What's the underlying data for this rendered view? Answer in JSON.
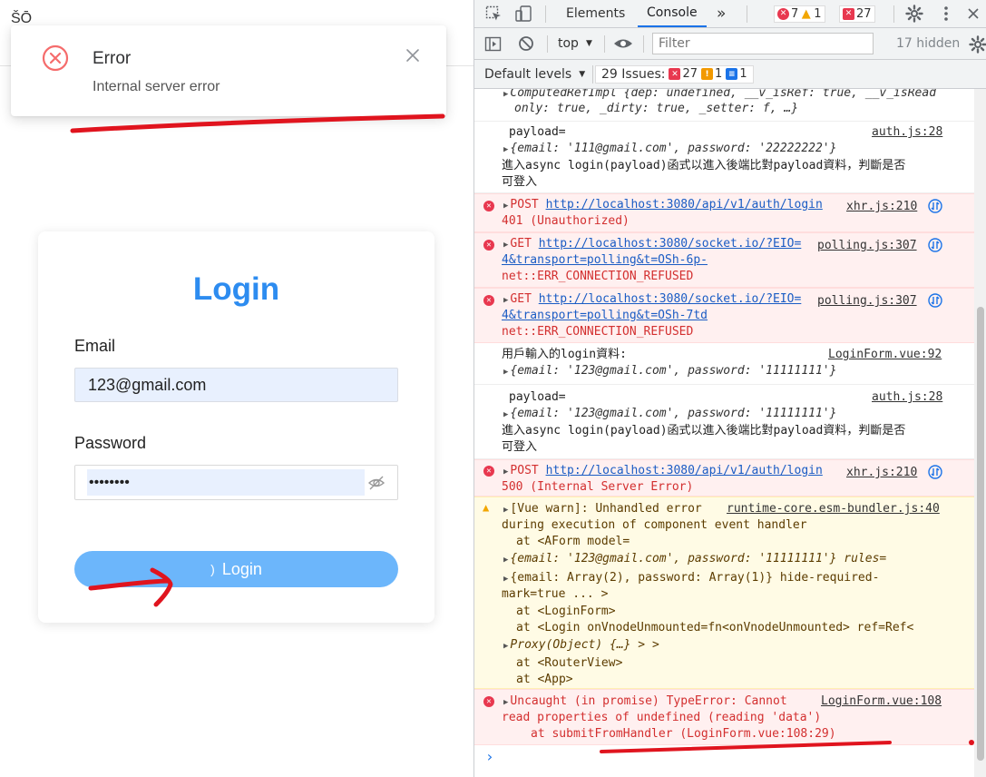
{
  "app": {
    "logo_text": "ŠŌ",
    "notification": {
      "title": "Error",
      "message": "Internal server error",
      "status_color": "#f56c6c"
    },
    "login": {
      "title": "Login",
      "email_label": "Email",
      "email_value": "123@gmail.com",
      "password_label": "Password",
      "password_value": "11111111",
      "button_label": "Login",
      "spinner_glyph": ")"
    },
    "annotation_color": "#e0141e"
  },
  "devtools": {
    "tabs": [
      "Elements",
      "Console"
    ],
    "more_tabs": "»",
    "error_count": "7",
    "warning_count": "1",
    "issue_count_badge": "27",
    "context": "top",
    "filter_placeholder": "Filter",
    "hidden_count": "17 hidden",
    "default_levels": "Default levels",
    "issues_label": "29 Issues:",
    "issues_errors": "27",
    "issues_warnings": "1",
    "issues_info": "1",
    "messages": {
      "m0": {
        "l1": "ComputedRefImpl {dep: undefined, __v_isRef: true, __v_isRead",
        "l2": "only: true, _dirty: true, _setter: f, …}"
      },
      "m1": {
        "l1": "payload=",
        "src": "auth.js:28",
        "l2": "{email: '111@gmail.com', password: '22222222'}",
        "l3": "進入async login(payload)函式以進入後端比對payload資料，判斷是否",
        "l4": "可登入"
      },
      "m2": {
        "method": "POST",
        "url": "http://localhost:3080/api/v1/auth/login",
        "src": "xhr.js:210",
        "l2": "401 (Unauthorized)"
      },
      "m3": {
        "method": "GET",
        "url": "http://localhost:3080/socket.io/?EIO=",
        "url2": "4&transport=polling&t=OSh-6p-",
        "src": "polling.js:307",
        "l3": "net::ERR_CONNECTION_REFUSED"
      },
      "m4": {
        "method": "GET",
        "url": "http://localhost:3080/socket.io/?EIO=",
        "url2": "4&transport=polling&t=OSh-7td",
        "src": "polling.js:307",
        "l3": "net::ERR_CONNECTION_REFUSED"
      },
      "m5": {
        "l1": "用戶輸入的login資料:",
        "src": "LoginForm.vue:92",
        "l2": "{email: '123@gmail.com', password: '11111111'}"
      },
      "m6": {
        "l1": "payload=",
        "src": "auth.js:28",
        "l2": "{email: '123@gmail.com', password: '11111111'}",
        "l3": "進入async login(payload)函式以進入後端比對payload資料，判斷是否",
        "l4": "可登入"
      },
      "m7": {
        "method": "POST",
        "url": "http://localhost:3080/api/v1/auth/login",
        "src": "xhr.js:210",
        "l2": "500 (Internal Server Error)"
      },
      "m8": {
        "l1": "[Vue warn]: Unhandled error",
        "src": "runtime-core.esm-bundler.js:40",
        "l2": "during execution of component event handler",
        "l3": "at <AForm model=",
        "l4": "{email: '123@gmail.com', password: '11111111'} rules=",
        "l5": "{email: Array(2), password: Array(1)} hide-required-",
        "l6": "mark=true  ... >",
        "l7": "at <LoginForm>",
        "l8": "at <Login onVnodeUnmounted=fn<onVnodeUnmounted> ref=Ref<",
        "l9": "Proxy(Object) {…} > >",
        "l10": "at <RouterView>",
        "l11": "at <App>"
      },
      "m9": {
        "l1": "Uncaught (in promise) TypeError: Cannot",
        "src": "LoginForm.vue:108",
        "l2": "read properties of undefined (reading 'data')",
        "l3": "at submitFromHandler (LoginForm.vue:108:29)"
      }
    },
    "prompt": "›"
  }
}
